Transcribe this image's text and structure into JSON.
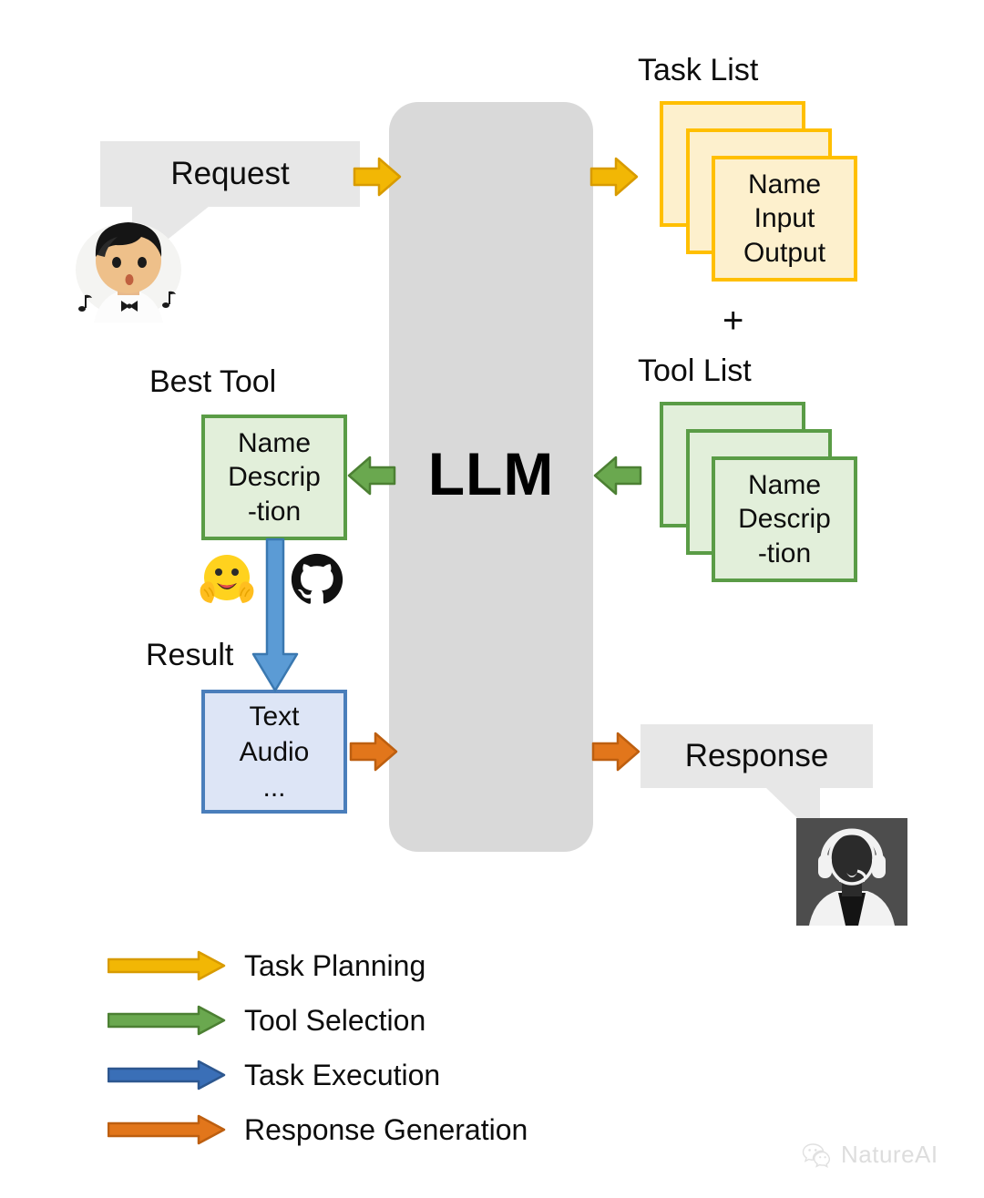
{
  "diagram": {
    "center": {
      "label": "LLM"
    },
    "user": {
      "bubble_text": "Request",
      "avatar_icon": "boy-singing-avatar"
    },
    "agent": {
      "bubble_text": "Response",
      "avatar_icon": "headset-agent-avatar"
    },
    "task_list": {
      "title": "Task List",
      "card_lines": [
        "Name",
        "Input",
        "Output"
      ],
      "card_count": 3,
      "border_color": "#ffbf00",
      "fill_color": "#fdf0cd"
    },
    "plus": "+",
    "tool_list": {
      "title": "Tool List",
      "card_lines": [
        "Name",
        "Descrip",
        "-tion"
      ],
      "card_count": 3,
      "border_color": "#5a9c46",
      "fill_color": "#e2efda"
    },
    "best_tool": {
      "title": "Best Tool",
      "card_lines": [
        "Name",
        "Descrip",
        "-tion"
      ],
      "border_color": "#5a9c46",
      "fill_color": "#e2efda"
    },
    "platform_icons": [
      {
        "name": "hugging-face-icon"
      },
      {
        "name": "github-icon"
      }
    ],
    "result": {
      "title": "Result",
      "card_lines": [
        "Text",
        "Audio",
        "..."
      ],
      "border_color": "#4a7ebb",
      "fill_color": "#dde5f6"
    },
    "legend": [
      {
        "label": "Task Planning",
        "color": "#f2b705"
      },
      {
        "label": "Tool Selection",
        "color": "#5a9c46"
      },
      {
        "label": "Task Execution",
        "color": "#3a6fb7"
      },
      {
        "label": "Response Generation",
        "color": "#e2761b"
      }
    ],
    "watermark": {
      "text": "NatureAI",
      "icon": "wechat-icon"
    }
  }
}
